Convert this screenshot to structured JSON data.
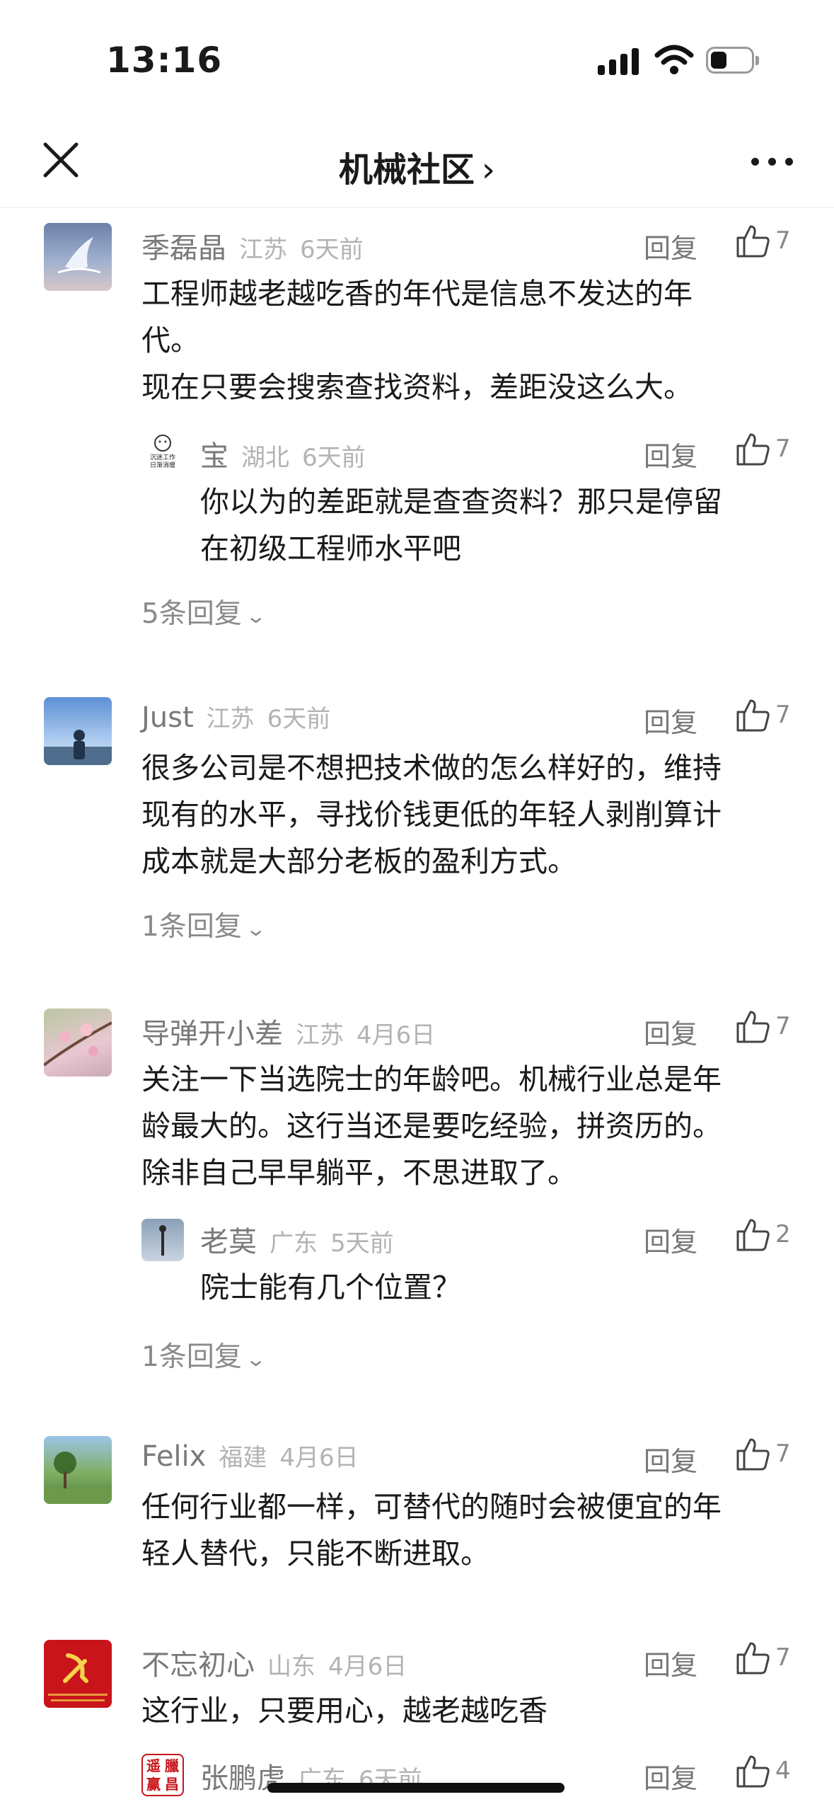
{
  "status": {
    "time": "13:16"
  },
  "nav": {
    "title": "机械社区",
    "chevron": "›"
  },
  "comments": [
    {
      "name": "季磊晶",
      "location": "江苏",
      "time": "6天前",
      "reply_label": "回复",
      "likes": "7",
      "lines": [
        "工程师越老越吃香的年代是信息不发达的年",
        "代。",
        "现在只要会搜索查找资料，差距没这么大。"
      ],
      "reply": {
        "name": "宝",
        "location": "湖北",
        "time": "6天前",
        "reply_label": "回复",
        "likes": "7",
        "avatar_text": [
          "沉迷工作",
          "日渐消瘦"
        ],
        "lines": [
          "你以为的差距就是查查资料？那只是停留",
          "在初级工程师水平吧"
        ]
      },
      "more_replies": "5条回复"
    },
    {
      "name": "Just",
      "location": "江苏",
      "time": "6天前",
      "reply_label": "回复",
      "likes": "7",
      "lines": [
        "很多公司是不想把技术做的怎么样好的，维持",
        "现有的水平，寻找价钱更低的年轻人剥削算计",
        "成本就是大部分老板的盈利方式。"
      ],
      "more_replies": "1条回复"
    },
    {
      "name": "导弹开小差",
      "location": "江苏",
      "time": "4月6日",
      "reply_label": "回复",
      "likes": "7",
      "lines": [
        "关注一下当选院士的年龄吧。机械行业总是年",
        "龄最大的。这行当还是要吃经验，拼资历的。",
        "除非自己早早躺平，不思进取了。"
      ],
      "reply": {
        "name": "老莫",
        "location": "广东",
        "time": "5天前",
        "reply_label": "回复",
        "likes": "2",
        "lines": [
          "院士能有几个位置？"
        ]
      },
      "more_replies": "1条回复"
    },
    {
      "name": "Felix",
      "location": "福建",
      "time": "4月6日",
      "reply_label": "回复",
      "likes": "7",
      "lines": [
        "任何行业都一样，可替代的随时会被便宜的年",
        "轻人替代，只能不断进取。"
      ]
    },
    {
      "name": "不忘初心",
      "location": "山东",
      "time": "4月6日",
      "reply_label": "回复",
      "likes": "7",
      "lines": [
        "这行业，只要用心，越老越吃香"
      ],
      "reply": {
        "name": "张鹏虎",
        "location": "广东",
        "time": "6天前",
        "reply_label": "回复",
        "likes": "4",
        "avatar_text": [
          "遥",
          "臘",
          "赢",
          "昌"
        ],
        "lines": []
      }
    }
  ],
  "icons": {
    "close": "close-icon",
    "more": "more-icon",
    "like": "thumbs-up-icon",
    "expand": "chevron-down-icon"
  },
  "colors": {
    "text": "#1a1a1a",
    "muted": "#888888",
    "meta": "#b3b3b3",
    "seal": "#c8141a"
  }
}
